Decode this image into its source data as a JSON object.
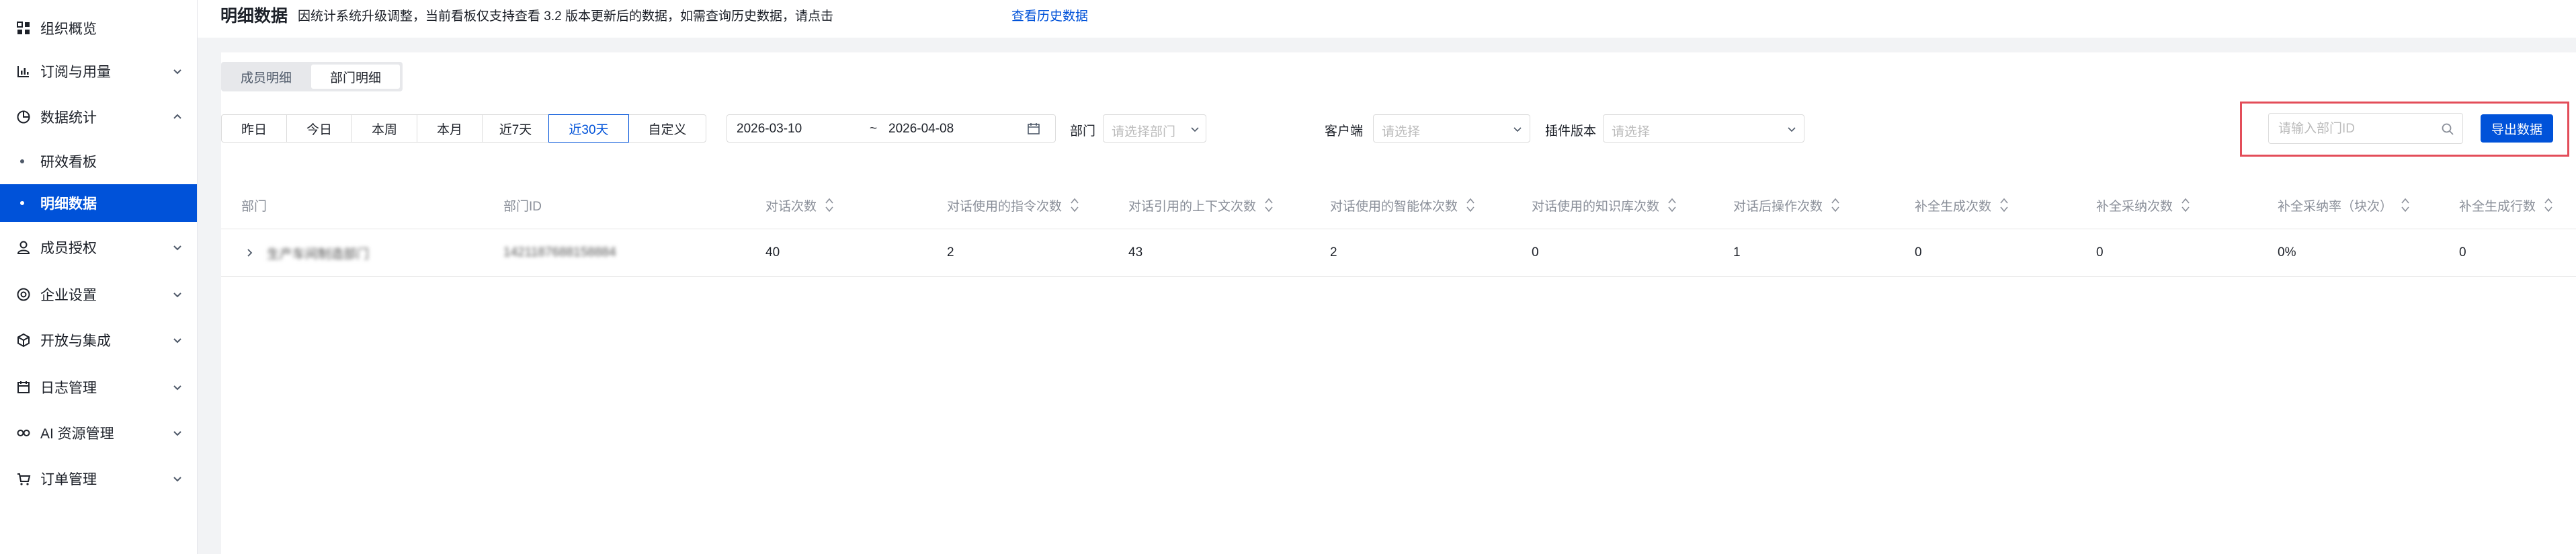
{
  "sidebar": {
    "items": [
      {
        "label": "组织概览",
        "icon": "grid-icon",
        "chevron": false
      },
      {
        "label": "订阅与用量",
        "icon": "bar-chart-icon",
        "chevron": true
      },
      {
        "label": "数据统计",
        "icon": "pie-chart-icon",
        "chevron": true,
        "expanded": true
      },
      {
        "label": "成员授权",
        "icon": "user-icon",
        "chevron": true
      },
      {
        "label": "企业设置",
        "icon": "settings-icon",
        "chevron": true
      },
      {
        "label": "开放与集成",
        "icon": "cube-icon",
        "chevron": true
      },
      {
        "label": "日志管理",
        "icon": "calendar-icon",
        "chevron": true
      },
      {
        "label": "AI 资源管理",
        "icon": "infinity-icon",
        "chevron": true
      },
      {
        "label": "订单管理",
        "icon": "cart-icon",
        "chevron": true
      }
    ],
    "subitems": [
      {
        "label": "研效看板"
      },
      {
        "label": "明细数据",
        "active": true
      }
    ]
  },
  "header": {
    "title": "明细数据",
    "notice": "因统计系统升级调整，当前看板仅支持查看 3.2 版本更新后的数据，如需查询历史数据，请点击",
    "notice_link": "查看历史数据"
  },
  "tabs": [
    "成员明细",
    "部门明细"
  ],
  "active_tab": "部门明细",
  "ranges": [
    "昨日",
    "今日",
    "本周",
    "本月",
    "近7天",
    "近30天",
    "自定义"
  ],
  "active_range": "近30天",
  "date_range": {
    "start": "2026-03-10",
    "separator": "~",
    "end": "2026-04-08"
  },
  "filters": {
    "dept_label": "部门",
    "dept_placeholder": "请选择部门",
    "client_label": "客户端",
    "client_placeholder": "请选择",
    "plugin_label": "插件版本",
    "plugin_placeholder": "请选择"
  },
  "search": {
    "placeholder": "请输入部门ID"
  },
  "export_label": "导出数据",
  "table": {
    "columns": [
      "部门",
      "部门ID",
      "对话次数",
      "对话使用的指令次数",
      "对话引用的上下文次数",
      "对话使用的智能体次数",
      "对话使用的知识库次数",
      "对话后操作次数",
      "补全生成次数",
      "补全采纳次数",
      "补全采纳率（块次）",
      "补全生成行数"
    ],
    "rows": [
      [
        "生产车间制造部门",
        "1421187688158884",
        "40",
        "2",
        "43",
        "2",
        "0",
        "1",
        "0",
        "0",
        "0%",
        "0"
      ]
    ]
  },
  "colors": {
    "accent": "#0052d9",
    "highlight": "#e34d59"
  }
}
